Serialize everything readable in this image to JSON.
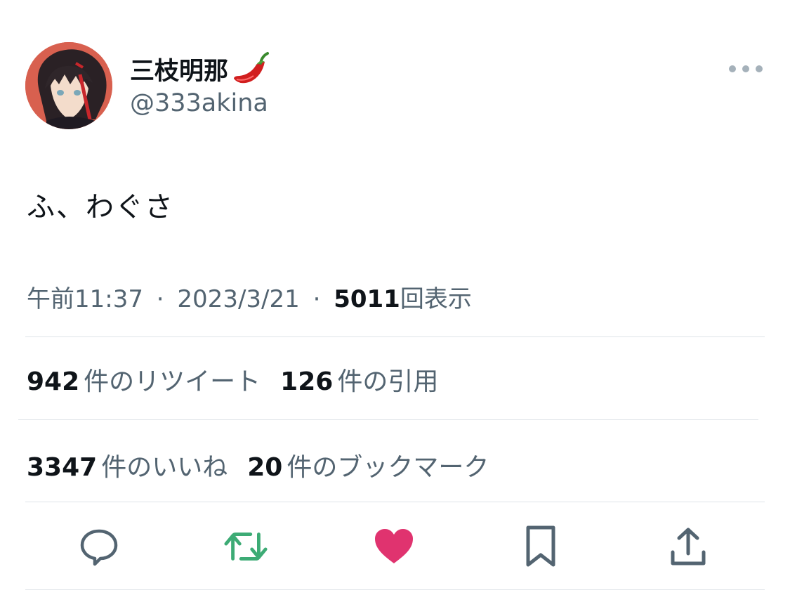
{
  "user": {
    "display_name": "三枝明那",
    "display_name_emoji": "chili-pepper-emoji",
    "handle": "@333akina"
  },
  "tweet": {
    "text": "ふ、わぐさ"
  },
  "meta": {
    "time": "午前11:37",
    "date": "2023/3/21",
    "separator": "·",
    "views_count": "5011",
    "views_label": "回表示"
  },
  "stats": {
    "retweets_count": "942",
    "retweets_label": "件のリツイート",
    "quotes_count": "126",
    "quotes_label": "件の引用",
    "likes_count": "3347",
    "likes_label": "件のいいね",
    "bookmarks_count": "20",
    "bookmarks_label": "件のブックマーク"
  },
  "actions": [
    {
      "name": "reply",
      "icon": "reply-icon",
      "color": "#536471"
    },
    {
      "name": "retweet",
      "icon": "retweet-icon",
      "color": "#3dab75",
      "active": true
    },
    {
      "name": "like",
      "icon": "heart-icon",
      "color": "#e0336f",
      "active": true
    },
    {
      "name": "bookmark",
      "icon": "bookmark-icon",
      "color": "#536471"
    },
    {
      "name": "share",
      "icon": "share-icon",
      "color": "#536471"
    }
  ],
  "colors": {
    "text_primary": "#0f1419",
    "text_secondary": "#536471",
    "divider": "#dfe4e8",
    "retweet_active": "#3dab75",
    "like_active": "#e0336f"
  }
}
